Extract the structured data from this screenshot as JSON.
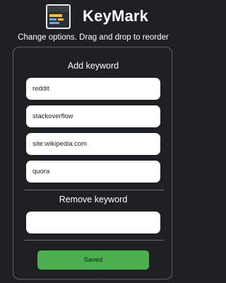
{
  "app": {
    "title": "KeyMark",
    "logo_icon": "keyboard-icon",
    "subtitle": "Change options. Drag and drop to reorder"
  },
  "add_section": {
    "title": "Add keyword",
    "keywords": [
      "reddit",
      "stackoverflow",
      "site:wikipedia.com",
      "quora"
    ]
  },
  "remove_section": {
    "title": "Remove keyword",
    "input_value": ""
  },
  "save_button": {
    "label": "Saved",
    "color": "#4caf50"
  },
  "colors": {
    "background": "#1f2023",
    "panel_border": "#5b6066",
    "field": "#ffffff"
  }
}
